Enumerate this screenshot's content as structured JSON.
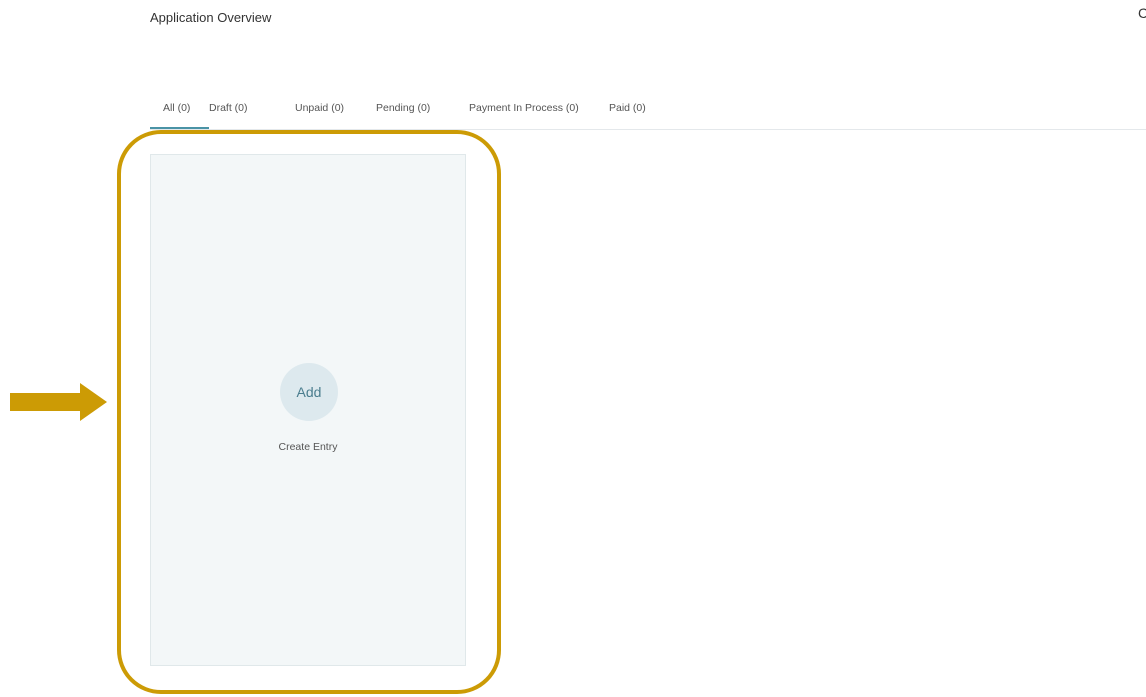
{
  "header": {
    "title": "Application Overview",
    "corner_glyph": "C"
  },
  "tabs": [
    {
      "label": "All (0)",
      "active": true
    },
    {
      "label": "Draft (0)",
      "active": false
    },
    {
      "label": "Unpaid (0)",
      "active": false
    },
    {
      "label": "Pending (0)",
      "active": false
    },
    {
      "label": "Payment In Process (0)",
      "active": false
    },
    {
      "label": "Paid (0)",
      "active": false
    }
  ],
  "card": {
    "add_label": "Add",
    "caption": "Create Entry"
  },
  "annotation": {
    "highlight_color": "#cc9b05",
    "arrow_icon": "arrow-right-icon"
  },
  "colors": {
    "accent": "#4a93a6",
    "card_background": "#f3f7f8",
    "add_circle": "#dde9ee"
  }
}
